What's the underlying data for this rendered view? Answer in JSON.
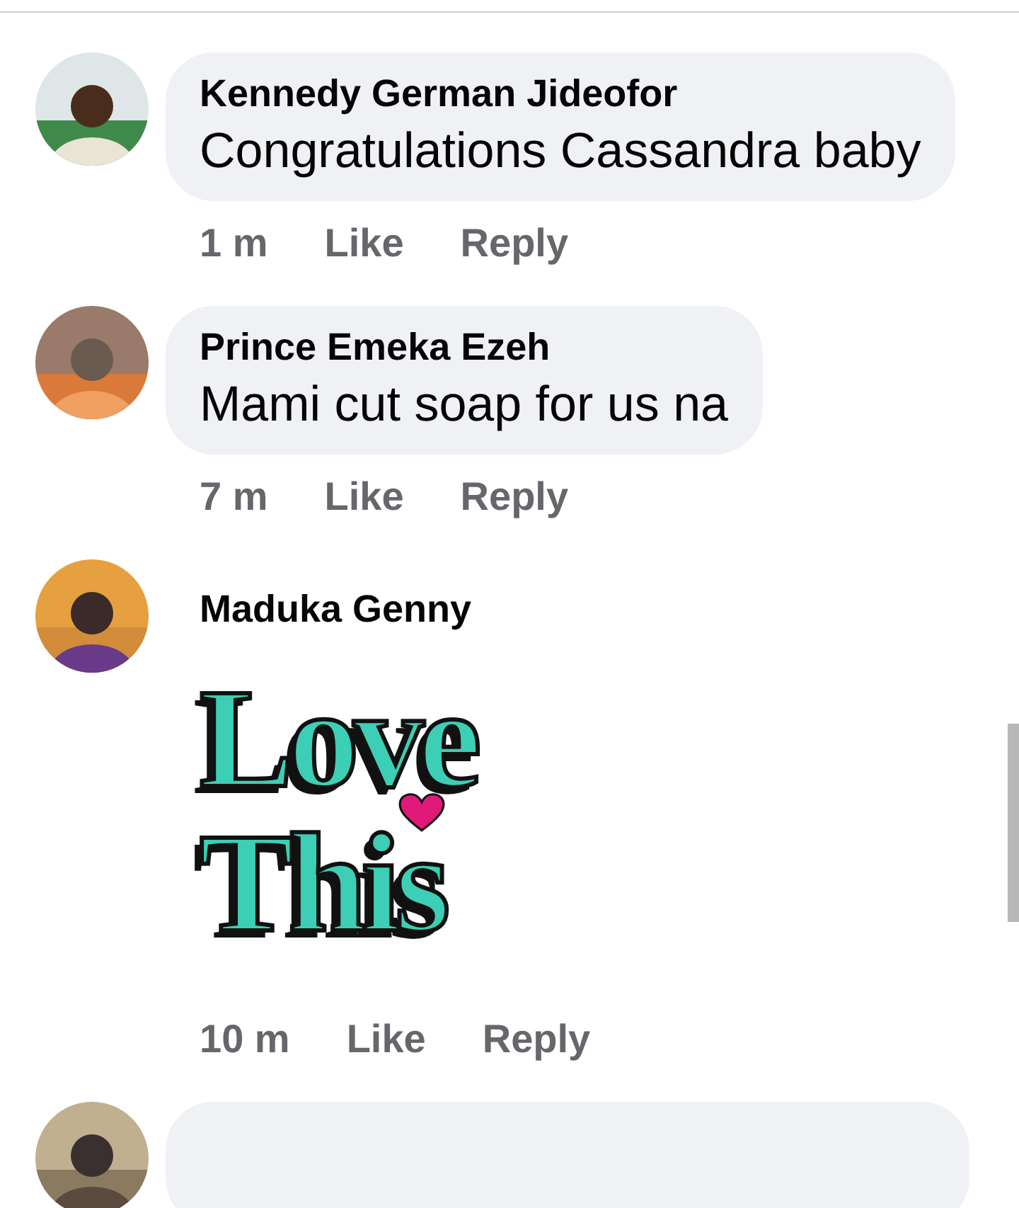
{
  "comments": [
    {
      "author": "Kennedy German Jideofor",
      "kind": "text",
      "body": "Congratulations Cassandra baby",
      "time": "1 m",
      "actions": [
        "Like",
        "Reply"
      ]
    },
    {
      "author": "Prince Emeka Ezeh",
      "kind": "text",
      "body": "Mami cut soap for us na",
      "time": "7 m",
      "actions": [
        "Like",
        "Reply"
      ]
    },
    {
      "author": "Maduka Genny",
      "kind": "sticker",
      "sticker": [
        "Love",
        "This"
      ],
      "time": "10 m",
      "actions": [
        "Like",
        "Reply"
      ]
    }
  ]
}
